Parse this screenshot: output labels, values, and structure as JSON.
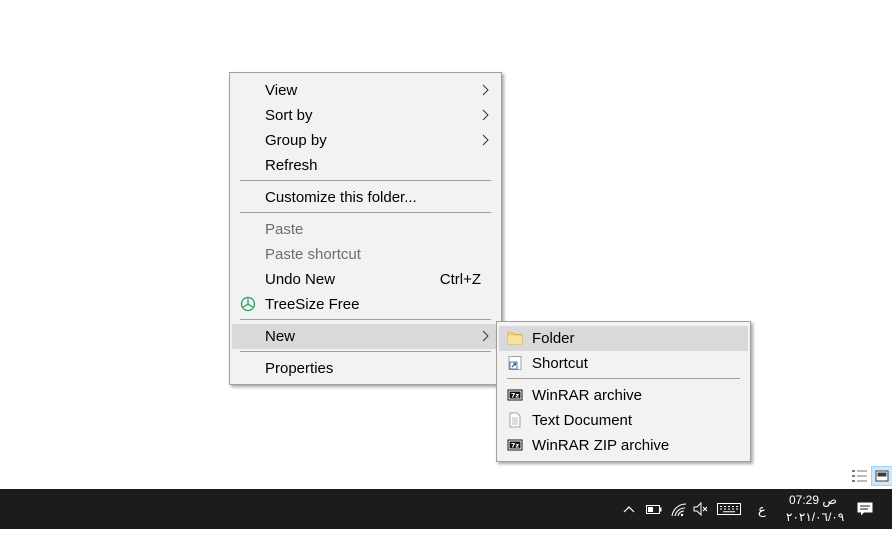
{
  "context_menu": {
    "items": [
      {
        "label": "View"
      },
      {
        "label": "Sort by"
      },
      {
        "label": "Group by"
      },
      {
        "label": "Refresh"
      },
      {
        "label": "Customize this folder..."
      },
      {
        "label": "Paste"
      },
      {
        "label": "Paste shortcut"
      },
      {
        "label": "Undo New",
        "shortcut": "Ctrl+Z"
      },
      {
        "label": "TreeSize Free"
      },
      {
        "label": "New"
      },
      {
        "label": "Properties"
      }
    ]
  },
  "new_submenu": {
    "items": [
      {
        "label": "Folder"
      },
      {
        "label": "Shortcut"
      },
      {
        "label": "WinRAR archive"
      },
      {
        "label": "Text Document"
      },
      {
        "label": "WinRAR ZIP archive"
      }
    ]
  },
  "taskbar": {
    "language": "ع",
    "time": "07:29 ص",
    "date": "٢٠٢١/٠٦/٠٩"
  },
  "colors": {
    "menu_bg": "#f2f2f2",
    "highlight": "#d9d9d9",
    "taskbar_bg": "#1c1c1c",
    "treesize_icon": "#2a9d62"
  },
  "icons": {
    "treesize": "treesize-icon",
    "folder": "folder-icon",
    "shortcut": "shortcut-icon",
    "winrar": "winrar-7z-icon",
    "text_document": "text-document-icon"
  }
}
